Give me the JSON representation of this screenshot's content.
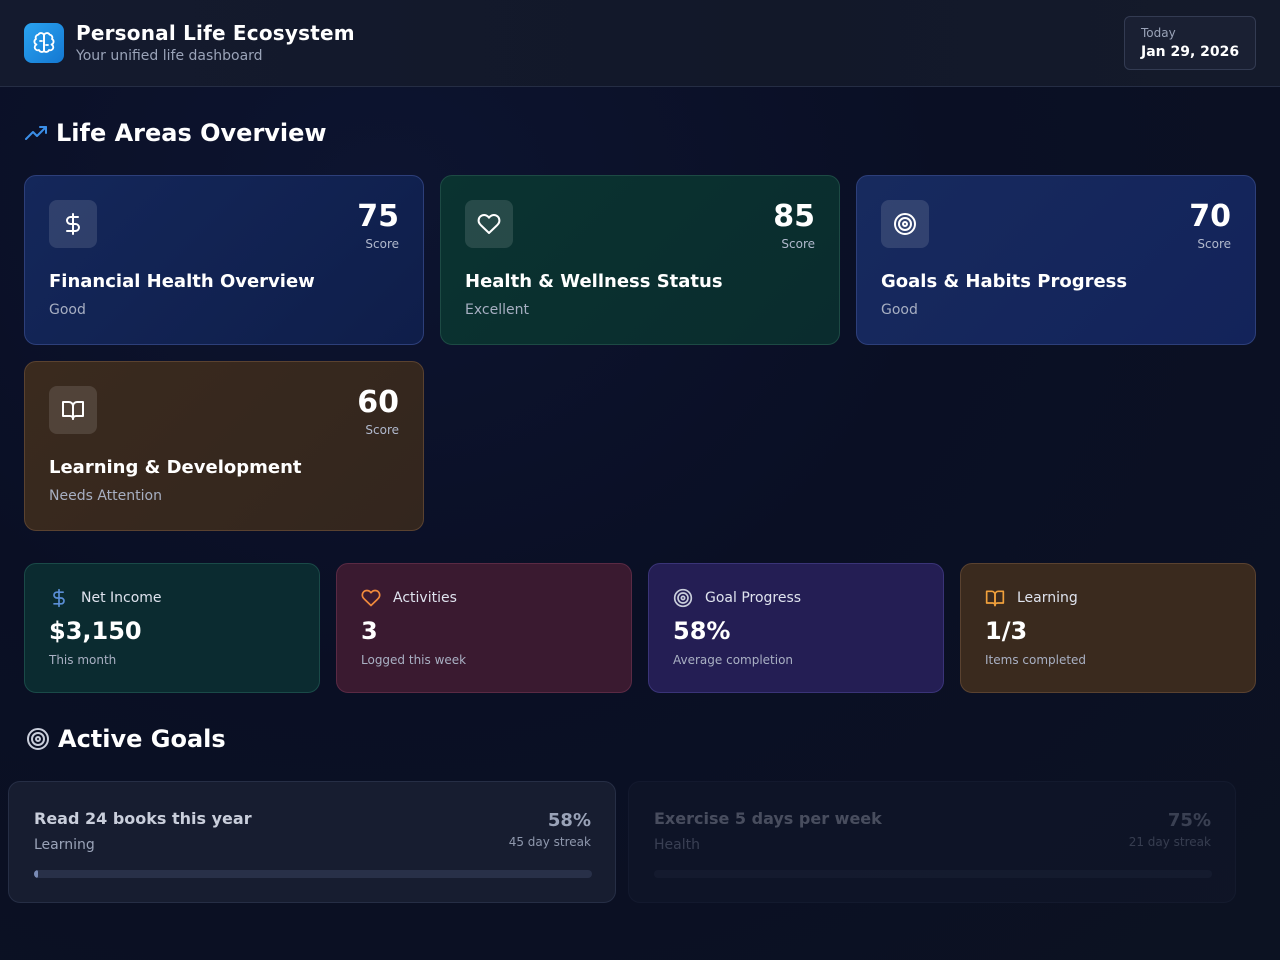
{
  "header": {
    "title": "Personal Life Ecosystem",
    "subtitle": "Your unified life dashboard",
    "logo_icon": "brain-icon",
    "date_label": "Today",
    "date_value": "Jan 29, 2026"
  },
  "life_areas": {
    "title": "Life Areas Overview",
    "icon": "trending-up-icon",
    "cards": [
      {
        "title": "Financial Health Overview",
        "score": "75",
        "score_label": "Score",
        "status": "Good",
        "icon": "dollar-icon",
        "accent": "#14275a"
      },
      {
        "title": "Health & Wellness Status",
        "score": "85",
        "score_label": "Score",
        "status": "Excellent",
        "icon": "heart-icon",
        "accent": "#0a3330"
      },
      {
        "title": "Goals & Habits Progress",
        "score": "70",
        "score_label": "Score",
        "status": "Good",
        "icon": "target-icon",
        "accent": "#172a5e"
      },
      {
        "title": "Learning & Development",
        "score": "60",
        "score_label": "Score",
        "status": "Needs Attention",
        "icon": "book-icon",
        "accent": "#3a2a1e"
      }
    ]
  },
  "stats": [
    {
      "label": "Net Income",
      "value": "$3,150",
      "sub": "This month",
      "icon": "dollar-icon",
      "icon_color": "#5b8fd6"
    },
    {
      "label": "Activities",
      "value": "3",
      "sub": "Logged this week",
      "icon": "heart-icon",
      "icon_color": "#f08a3c"
    },
    {
      "label": "Goal Progress",
      "value": "58%",
      "sub": "Average completion",
      "icon": "target-icon",
      "icon_color": "#c9cedb"
    },
    {
      "label": "Learning",
      "value": "1/3",
      "sub": "Items completed",
      "icon": "book-icon",
      "icon_color": "#f0a03c"
    }
  ],
  "active_goals": {
    "title": "Active Goals",
    "icon": "target-icon",
    "goals": [
      {
        "title": "Read 24 books this year",
        "category": "Learning",
        "percent": "58%",
        "streak": "45 day streak",
        "progress": 0.008
      },
      {
        "title": "Exercise 5 days per week",
        "category": "Health",
        "percent": "75%",
        "streak": "21 day streak",
        "progress": 0
      }
    ]
  }
}
